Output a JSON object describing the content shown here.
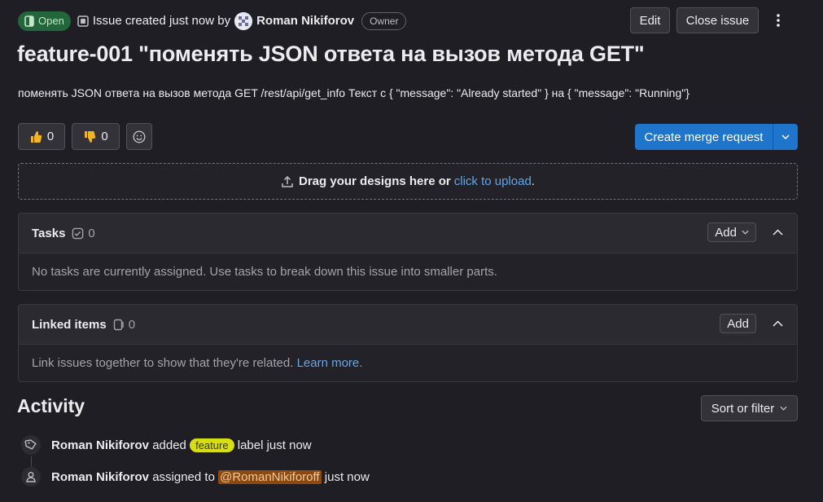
{
  "header": {
    "status": "Open",
    "created_text": "Issue created just now by",
    "author": "Roman Nikiforov",
    "role": "Owner",
    "edit_label": "Edit",
    "close_label": "Close issue"
  },
  "issue": {
    "title": "feature-001 \"поменять JSON ответа на вызов метода GET\"",
    "description": "поменять JSON ответа на вызов метода GET /rest/api/get_info Текст с { \"message\": \"Already started\" } на { \"message\": \"Running\"}"
  },
  "reactions": {
    "thumbs_up_count": "0",
    "thumbs_down_count": "0"
  },
  "merge_request": {
    "label": "Create merge request"
  },
  "designs": {
    "text": "Drag your designs here or",
    "link": "click to upload",
    "suffix": "."
  },
  "tasks": {
    "title": "Tasks",
    "count": "0",
    "add_label": "Add",
    "empty_text": "No tasks are currently assigned. Use tasks to break down this issue into smaller parts."
  },
  "linked": {
    "title": "Linked items",
    "count": "0",
    "add_label": "Add",
    "empty_text": "Link issues together to show that they're related.",
    "learn_more": "Learn more."
  },
  "activity": {
    "title": "Activity",
    "sort_label": "Sort or filter",
    "events": [
      {
        "who": "Roman Nikiforov",
        "verb": "added",
        "label": "feature",
        "rest": "label just now"
      },
      {
        "who": "Roman Nikiforov",
        "verb": "assigned to",
        "mention": "@RomanNikiforoff",
        "rest": "just now"
      }
    ]
  },
  "colors": {
    "background": "#1f1e24",
    "open_badge": "#24663b",
    "primary_button": "#1f75cb",
    "link": "#63a6e9",
    "label_feature": "#d7de14",
    "mention_bg": "#8c4a10"
  }
}
